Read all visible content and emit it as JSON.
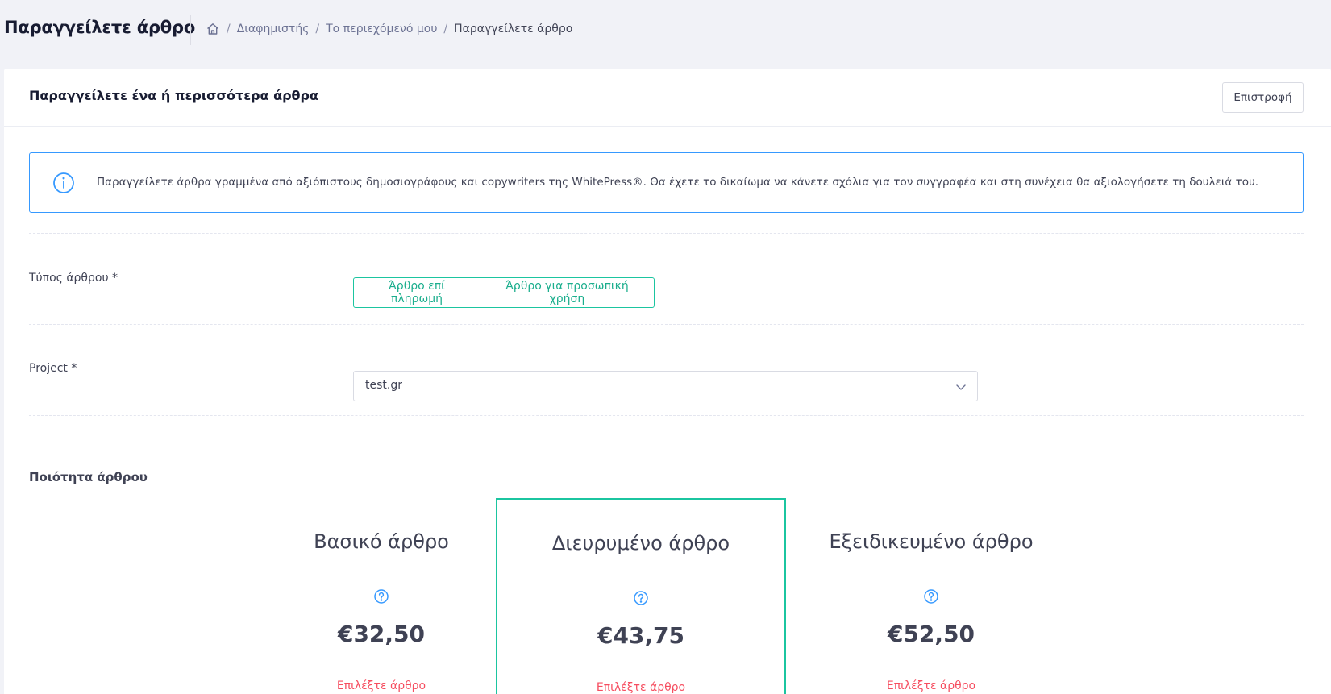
{
  "header": {
    "page_title": "Παραγγείλετε άρθρο",
    "breadcrumb": [
      "Διαφημιστής",
      "Το περιεχόμενό μου",
      "Παραγγείλετε άρθρο"
    ]
  },
  "card": {
    "title": "Παραγγείλετε ένα ή περισσότερα άρθρα",
    "back_label": "Επιστροφή",
    "info_text": "Παραγγείλετε άρθρα γραμμένα από αξιόπιστους δημοσιογράφους και copywriters της WhitePress®. Θα έχετε το δικαίωμα να κάνετε σχόλια για τον συγγραφέα και στη συνέχεια θα αξιολογήσετε τη δουλειά του."
  },
  "form": {
    "article_type_label": "Τύπος άρθρου *",
    "article_type_options": [
      "Άρθρο επί πληρωμή",
      "Άρθρο για προσωπική χρήση"
    ],
    "project_label": "Project *",
    "project_value": "test.gr",
    "quality_label": "Ποιότητα άρθρου"
  },
  "packages": [
    {
      "name": "Βασικό άρθρο",
      "price": "€32,50",
      "link": "Επιλέξτε άρθρο"
    },
    {
      "name": "Διευρυμένο άρθρο",
      "price": "€43,75",
      "link": "Επιλέξτε άρθρο"
    },
    {
      "name": "Εξειδικευμένο άρθρο",
      "price": "€52,50",
      "link": "Επιλέξτε άρθρο"
    }
  ],
  "colors": {
    "accent": "#1bc5a0",
    "info": "#3699ff",
    "danger": "#f64e60",
    "page_bg": "#f1f2f7"
  },
  "icons": {
    "breadcrumb_home": "home-icon",
    "info": "info-circle-icon",
    "help": "question-circle-icon",
    "select": "chevron-down-icon"
  }
}
